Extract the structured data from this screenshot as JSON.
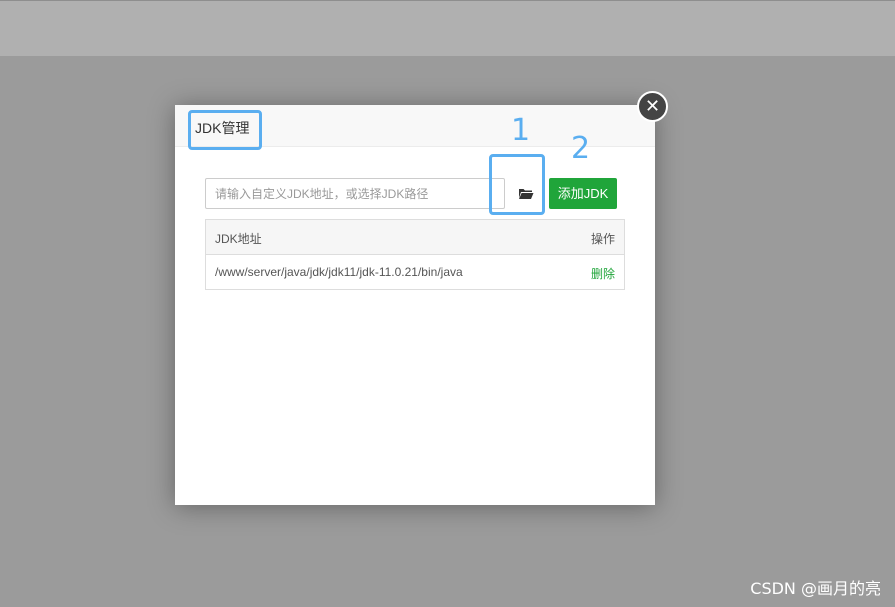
{
  "dialog": {
    "title": "JDK管理",
    "close_label": "✕",
    "input": {
      "placeholder": "请输入自定义JDK地址，或选择JDK路径",
      "value": ""
    },
    "add_button_label": "添加JDK",
    "annotations": {
      "one": "1",
      "two": "2"
    },
    "table": {
      "headers": {
        "path": "JDK地址",
        "actions": "操作"
      },
      "rows": [
        {
          "path": "/www/server/java/jdk/jdk11/jdk-11.0.21/bin/java",
          "action": "删除"
        }
      ]
    }
  },
  "watermark": "CSDN @画月的亮",
  "colors": {
    "accent_green": "#20a53a",
    "annotation_blue": "#5aaef0",
    "overlay_gray": "#9b9b9b"
  },
  "icons": {
    "close": "close-icon",
    "folder": "folder-open-icon"
  }
}
